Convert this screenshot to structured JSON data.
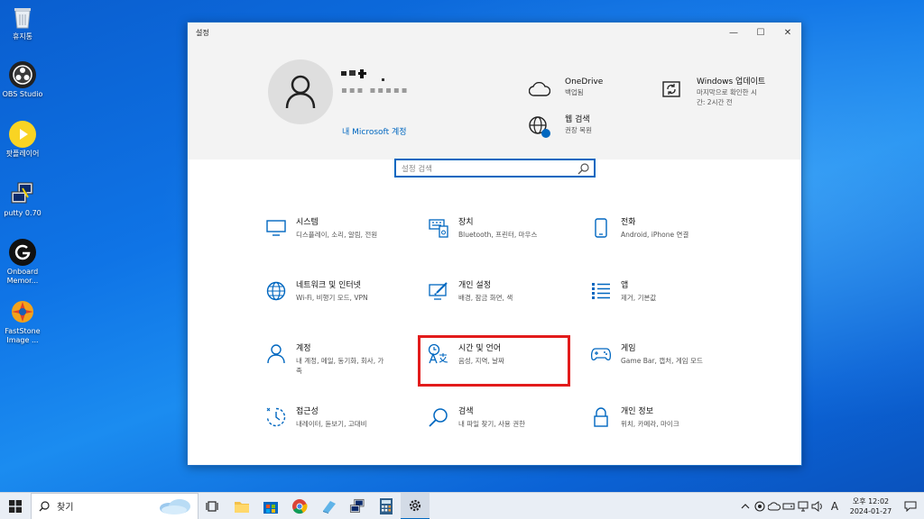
{
  "desktop": {
    "icons": [
      {
        "label": "휴지통"
      },
      {
        "label": "OBS Studio"
      },
      {
        "label": "팟플레이어"
      },
      {
        "label": "putty 0.70"
      },
      {
        "label": "Onboard Memor..."
      },
      {
        "label": "FastStone Image ..."
      }
    ]
  },
  "window": {
    "title": "설정",
    "controls": {
      "minimize": "—",
      "maximize": "☐",
      "close": "✕"
    }
  },
  "account": {
    "name": "▪▪▪ ▪▪▪▪▪",
    "link": "내 Microsoft 계정"
  },
  "header_items": {
    "onedrive": {
      "title": "OneDrive",
      "subtitle": "백업됨"
    },
    "web_search": {
      "title": "웹 검색",
      "subtitle": "권장 복원"
    },
    "windows_update": {
      "title": "Windows 업데이트",
      "subtitle1": "마지막으로 확인한 시",
      "subtitle2": "간: 2시간 전"
    }
  },
  "search": {
    "placeholder": "설정 검색"
  },
  "categories": {
    "system": {
      "title": "시스템",
      "subtitle": "디스플레이, 소리, 알림, 전원"
    },
    "devices": {
      "title": "장치",
      "subtitle": "Bluetooth, 프린터, 마우스"
    },
    "phone": {
      "title": "전화",
      "subtitle": "Android, iPhone 연결"
    },
    "network": {
      "title": "네트워크 및 인터넷",
      "subtitle": "Wi-Fi, 비행기 모드, VPN"
    },
    "personalization": {
      "title": "개인 설정",
      "subtitle": "배경, 잠금 화면, 색"
    },
    "apps": {
      "title": "앱",
      "subtitle": "제거, 기본값"
    },
    "accounts": {
      "title": "계정",
      "subtitle1": "내 계정, 메일, 동기화, 회사, 가",
      "subtitle2": "족"
    },
    "time_language": {
      "title": "시간 및 언어",
      "subtitle": "음성, 지역, 날짜"
    },
    "gaming": {
      "title": "게임",
      "subtitle": "Game Bar, 캡처, 게임 모드"
    },
    "ease_of_access": {
      "title": "접근성",
      "subtitle": "내레이터, 돋보기, 고대비"
    },
    "search": {
      "title": "검색",
      "subtitle": "내 파일 찾기, 사용 권한"
    },
    "privacy": {
      "title": "개인 정보",
      "subtitle": "위치, 카메라, 마이크"
    }
  },
  "taskbar": {
    "search_placeholder": "찾기",
    "ime": "A",
    "time": "오후 12:02",
    "date": "2024-01-27"
  },
  "colors": {
    "accent": "#0067c0",
    "highlight": "#e21b1b"
  }
}
